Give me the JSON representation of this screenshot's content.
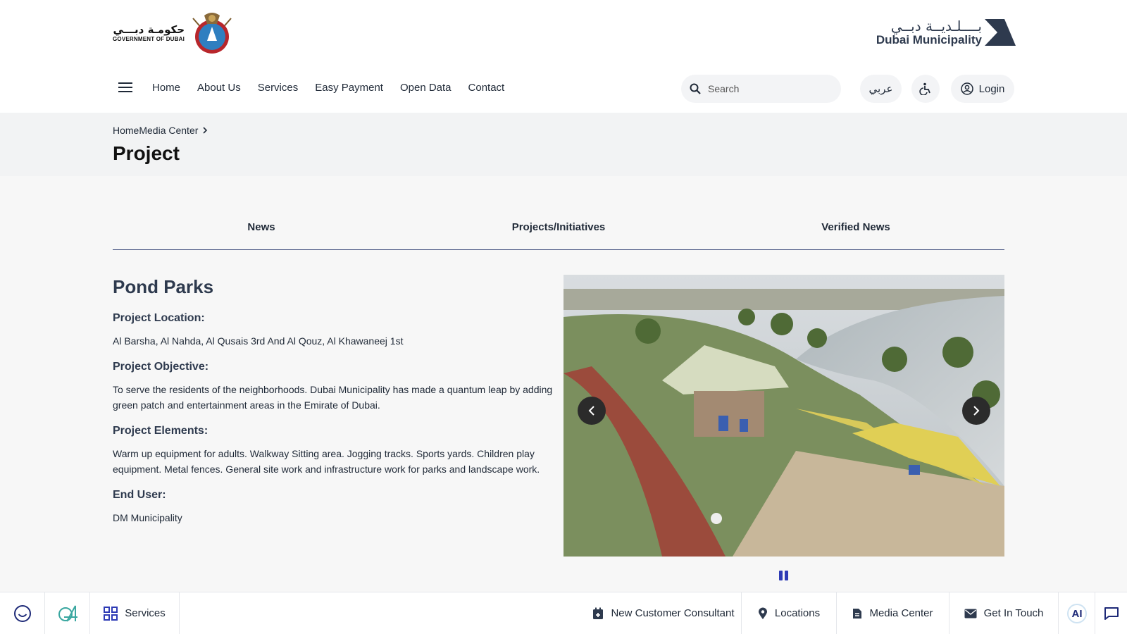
{
  "header": {
    "gov_logo": {
      "arabic": "حكومـة دبـــي",
      "english": "GOVERNMENT OF DUBAI"
    },
    "dm_logo": {
      "arabic": "بــــلـديــة دبــي",
      "english": "Dubai Municipality"
    },
    "nav": [
      "Home",
      "About Us",
      "Services",
      "Easy Payment",
      "Open Data",
      "Contact"
    ],
    "search_placeholder": "Search",
    "lang_label": "عربي",
    "login_label": "Login"
  },
  "title_band": {
    "breadcrumb": "HomeMedia Center",
    "title": "Project"
  },
  "tabs": [
    "News",
    "Projects/Initiatives",
    "Verified News"
  ],
  "project": {
    "name": "Pond Parks",
    "sections": [
      {
        "heading": "Project Location:",
        "body": "Al Barsha, Al Nahda, Al Qusais 3rd And Al Qouz, Al Khawaneej 1st"
      },
      {
        "heading": "Project Objective:",
        "body": "To serve the residents of the neighborhoods. Dubai Municipality has made a quantum leap by adding green patch and entertainment areas in the Emirate of Dubai."
      },
      {
        "heading": "Project Elements:",
        "body": "Warm up equipment for adults. Walkway Sitting area. Jogging tracks. Sports yards. Children play equipment. Metal fences. General site work and infrastructure work for parks and landscape work."
      },
      {
        "heading": "End User:",
        "body": "DM Municipality"
      }
    ]
  },
  "carousel": {
    "icons": {
      "prev": "chevron-left-icon",
      "next": "chevron-right-icon",
      "pause": "pause-icon"
    }
  },
  "bottom_bar": {
    "services_label": "Services",
    "consultant_label": "New Customer Consultant",
    "locations_label": "Locations",
    "media_label": "Media Center",
    "contact_label": "Get In Touch",
    "ai_label": "AI"
  },
  "colors": {
    "accent": "#2e3bb5",
    "text_dark": "#2e3a4e",
    "tab_underline": "#3b4a7a",
    "band_bg": "#f2f3f4"
  }
}
